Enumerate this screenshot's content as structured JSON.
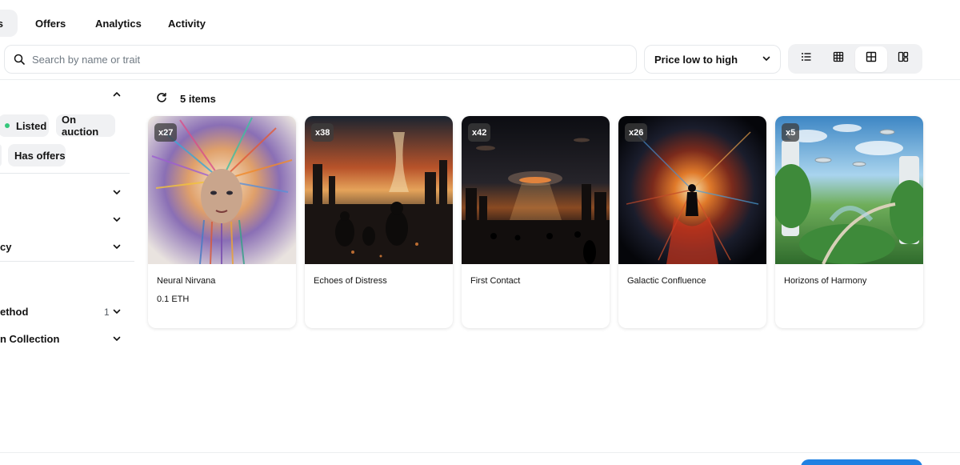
{
  "tabs": [
    {
      "label": "s",
      "active": true
    },
    {
      "label": "Offers"
    },
    {
      "label": "Analytics"
    },
    {
      "label": "Activity"
    }
  ],
  "search": {
    "placeholder": "Search by name or trait",
    "value": ""
  },
  "sort": {
    "selected": "Price low to high"
  },
  "view_modes": [
    {
      "icon": "list-view-icon"
    },
    {
      "icon": "small-grid-view-icon"
    },
    {
      "icon": "large-grid-view-icon",
      "active": true
    },
    {
      "icon": "mosaic-view-icon"
    }
  ],
  "sidebar": {
    "status_chips": [
      "Listed",
      "On auction",
      "Has offers"
    ],
    "sections": [
      {
        "title": ""
      },
      {
        "title": ""
      },
      {
        "title": "cy"
      },
      {
        "title": "ethod",
        "count": "1"
      },
      {
        "title": "n Collection"
      }
    ]
  },
  "results": {
    "count_label": "5 items"
  },
  "items": [
    {
      "name": "Neural Nirvana",
      "badge": "x27",
      "price": "0.1 ETH"
    },
    {
      "name": "Echoes of Distress",
      "badge": "x38",
      "price": ""
    },
    {
      "name": "First Contact",
      "badge": "x42",
      "price": ""
    },
    {
      "name": "Galactic Confluence",
      "badge": "x26",
      "price": ""
    },
    {
      "name": "Horizons of Harmony",
      "badge": "x5",
      "price": ""
    }
  ],
  "colors": {
    "accent": "#2081e2",
    "listed_dot": "#34c77b",
    "chip_bg": "#f0f1f3",
    "border": "#e5e8eb"
  }
}
